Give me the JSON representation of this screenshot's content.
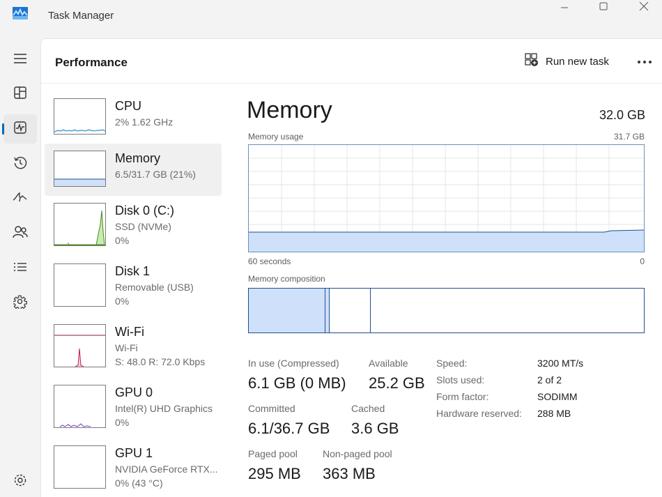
{
  "window": {
    "title": "Task Manager"
  },
  "header": {
    "page_title": "Performance",
    "run_new_task": "Run new task"
  },
  "nav": {
    "items": [
      {
        "icon": "hamburger-menu-icon"
      },
      {
        "icon": "processes-icon"
      },
      {
        "icon": "performance-icon",
        "active": true
      },
      {
        "icon": "app-history-icon"
      },
      {
        "icon": "startup-apps-icon"
      },
      {
        "icon": "users-icon"
      },
      {
        "icon": "details-icon"
      },
      {
        "icon": "services-icon"
      },
      {
        "icon": "settings-icon"
      }
    ]
  },
  "resources": [
    {
      "name": "CPU",
      "line1": "2%  1.62 GHz",
      "line2": ""
    },
    {
      "name": "Memory",
      "line1": "6.5/31.7 GB (21%)",
      "line2": ""
    },
    {
      "name": "Disk 0 (C:)",
      "line1": "SSD (NVMe)",
      "line2": "0%"
    },
    {
      "name": "Disk 1",
      "line1": "Removable (USB)",
      "line2": "0%"
    },
    {
      "name": "Wi-Fi",
      "line1": "Wi-Fi",
      "line2": "S: 48.0  R: 72.0 Kbps"
    },
    {
      "name": "GPU 0",
      "line1": "Intel(R) UHD Graphics",
      "line2": "0%"
    },
    {
      "name": "GPU 1",
      "line1": "NVIDIA GeForce RTX...",
      "line2": "0%  (43 °C)"
    }
  ],
  "memory": {
    "title": "Memory",
    "total": "32.0 GB",
    "usage_label": "Memory usage",
    "usage_max": "31.7 GB",
    "time_left": "60 seconds",
    "time_right": "0",
    "composition_label": "Memory composition",
    "in_use_label": "In use (Compressed)",
    "in_use_value": "6.1 GB (0 MB)",
    "available_label": "Available",
    "available_value": "25.2 GB",
    "committed_label": "Committed",
    "committed_value": "6.1/36.7 GB",
    "cached_label": "Cached",
    "cached_value": "3.6 GB",
    "paged_label": "Paged pool",
    "paged_value": "295 MB",
    "nonpaged_label": "Non-paged pool",
    "nonpaged_value": "363 MB",
    "specs": [
      {
        "label": "Speed:",
        "value": "3200 MT/s"
      },
      {
        "label": "Slots used:",
        "value": "2 of 2"
      },
      {
        "label": "Form factor:",
        "value": "SODIMM"
      },
      {
        "label": "Hardware reserved:",
        "value": "288 MB"
      }
    ]
  },
  "colors": {
    "accent": "#0067c0",
    "memory_fill": "#cfe0fa",
    "memory_line": "#1f4e8c"
  }
}
